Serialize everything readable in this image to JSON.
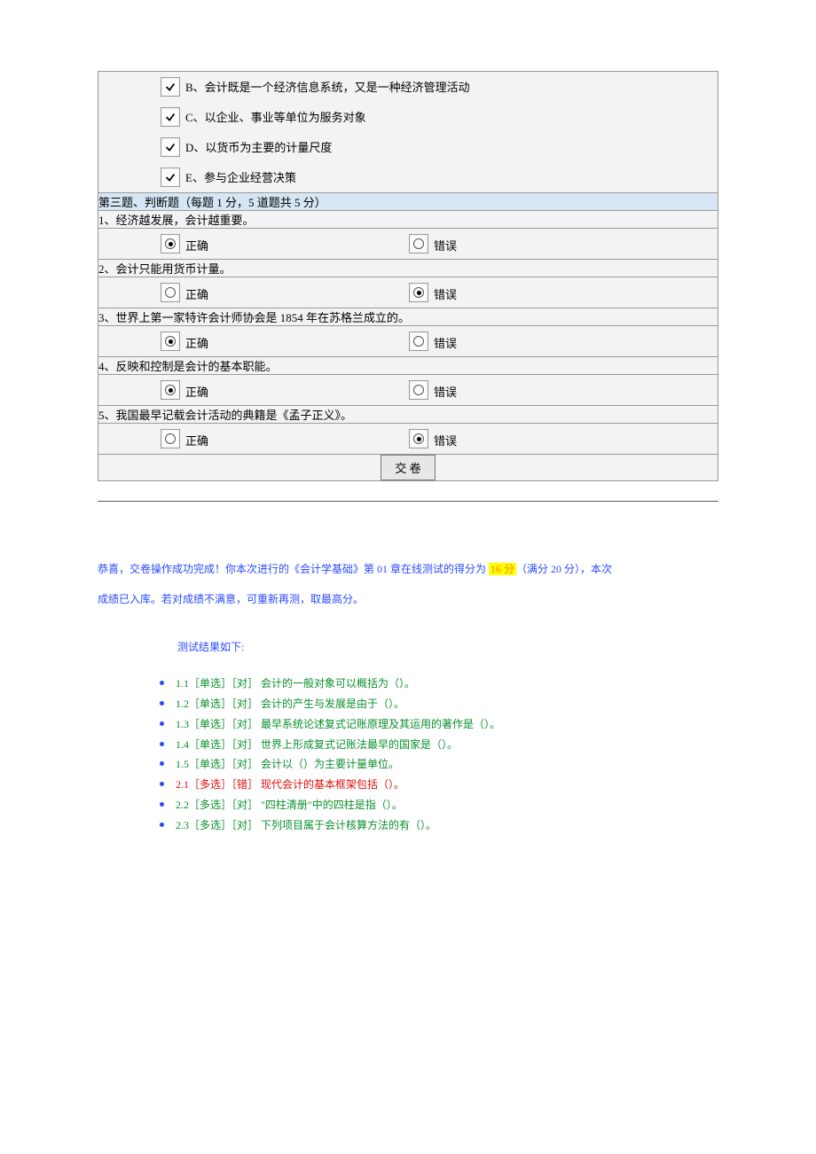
{
  "multi": {
    "options": [
      {
        "label": "B、会计既是一个经济信息系统，又是一种经济管理活动",
        "checked": true
      },
      {
        "label": "C、以企业、事业等单位为服务对象",
        "checked": true
      },
      {
        "label": "D、以货币为主要的计量尺度",
        "checked": true
      },
      {
        "label": "E、参与企业经营决策",
        "checked": true
      }
    ]
  },
  "section3_header": "第三题、判断题（每题 1 分，5 道题共 5 分）",
  "tf": {
    "correct": "正确",
    "wrong": "错误",
    "items": [
      {
        "q": "1、经济越发展，会计越重要。",
        "answer": "correct"
      },
      {
        "q": "2、会计只能用货币计量。",
        "answer": "wrong"
      },
      {
        "q": "3、世界上第一家特许会计师协会是 1854 年在苏格兰成立的。",
        "answer": "correct"
      },
      {
        "q": "4、反映和控制是会计的基本职能。",
        "answer": "correct"
      },
      {
        "q": "5、我国最早记载会计活动的典籍是《孟子正义》。",
        "answer": "wrong"
      }
    ]
  },
  "submit_label": "交 卷",
  "msg": {
    "part1": "恭喜，交卷操作成功完成！你本次进行的《会计学基础》第   01 章在线测试的得分为   ",
    "score": "16 分",
    "part2": "（满分 20 分），本次",
    "part3": "成绩已入库。若对成绩不满意，可重新再测，取最高分。"
  },
  "results": {
    "title": "测试结果如下:",
    "items": [
      {
        "text": "1.1［单选］［对］ 会计的一般对象可以概括为（）。",
        "cls": "green"
      },
      {
        "text": "1.2［单选］［对］ 会计的产生与发展是由于（）。",
        "cls": "green"
      },
      {
        "text": "1.3［单选］［对］ 最早系统论述复式记账原理及其运用的著作是（）。",
        "cls": "green"
      },
      {
        "text": "1.4［单选］［对］ 世界上形成复式记账法最早的国家是（）。",
        "cls": "green"
      },
      {
        "text": "1.5［单选］［对］ 会计以（）为主要计量单位。",
        "cls": "green"
      },
      {
        "text": "2.1［多选］［错］ 现代会计的基本框架包括（）。",
        "cls": "red"
      },
      {
        "text": "2.2［多选］［对］ \"四柱清册\"中的四柱是指（）。",
        "cls": "green"
      },
      {
        "text": "2.3［多选］［对］ 下列项目属于会计核算方法的有（）。",
        "cls": "green"
      }
    ]
  }
}
